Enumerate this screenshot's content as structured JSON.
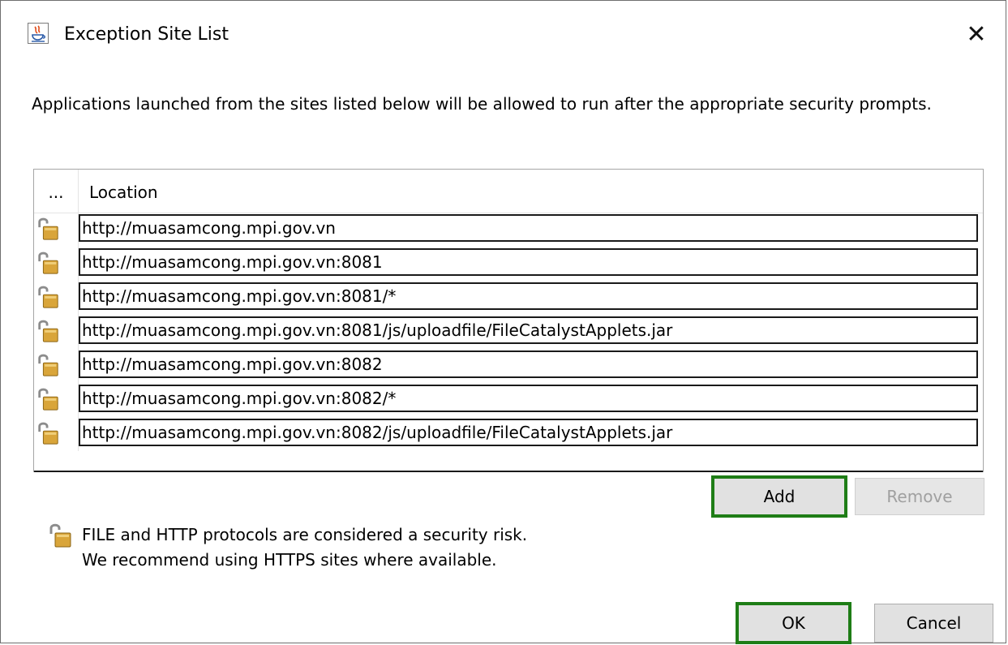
{
  "window": {
    "title": "Exception Site List",
    "close_glyph": "✕",
    "app_icon": "java-icon"
  },
  "description": "Applications launched from the sites listed below will be allowed to run after the appropriate security prompts.",
  "table": {
    "columns": [
      "...",
      "Location"
    ],
    "rows": [
      {
        "icon": "unlocked-padlock-icon",
        "location": "http://muasamcong.mpi.gov.vn"
      },
      {
        "icon": "unlocked-padlock-icon",
        "location": "http://muasamcong.mpi.gov.vn:8081"
      },
      {
        "icon": "unlocked-padlock-icon",
        "location": "http://muasamcong.mpi.gov.vn:8081/*"
      },
      {
        "icon": "unlocked-padlock-icon",
        "location": "http://muasamcong.mpi.gov.vn:8081/js/uploadfile/FileCatalystApplets.jar"
      },
      {
        "icon": "unlocked-padlock-icon",
        "location": "http://muasamcong.mpi.gov.vn:8082"
      },
      {
        "icon": "unlocked-padlock-icon",
        "location": "http://muasamcong.mpi.gov.vn:8082/*"
      },
      {
        "icon": "unlocked-padlock-icon",
        "location": "http://muasamcong.mpi.gov.vn:8082/js/uploadfile/FileCatalystApplets.jar"
      }
    ]
  },
  "buttons": {
    "add": "Add",
    "remove": "Remove",
    "ok": "OK",
    "cancel": "Cancel"
  },
  "warning": {
    "icon": "unlocked-padlock-icon",
    "line1": "FILE and HTTP protocols are considered a security risk.",
    "line2": "We recommend using HTTPS sites where available."
  },
  "colors": {
    "focus_border": "#1e7d16",
    "lock_gold": "#d9a53a",
    "lock_shackle": "#8c8c8c"
  }
}
